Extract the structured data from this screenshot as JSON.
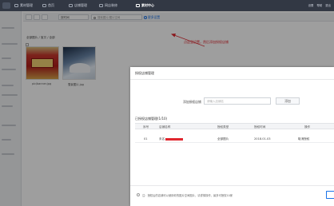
{
  "topbar": {
    "nav": [
      {
        "label": "素材管理",
        "icon": "picture-icon",
        "active": false
      },
      {
        "label": "首页",
        "icon": "home-icon",
        "active": false
      },
      {
        "label": "店铺管理",
        "icon": "shop-icon",
        "active": false
      },
      {
        "label": "网店装修",
        "icon": "decorate-icon",
        "active": false
      },
      {
        "label": "素材中心",
        "icon": "folder-icon",
        "active": true
      }
    ],
    "right_items": [
      "设置",
      "帮助",
      "退出"
    ]
  },
  "toolbar": {
    "sort_select": "按时间",
    "search_placeholder": "搜索图片/图片空间",
    "more_settings": "更多设置"
  },
  "breadcrumb": "全部图片 / 宝贝 / 全部",
  "thumbnails": [
    {
      "caption": "pic/banner.jpg"
    },
    {
      "caption": "雪景图片.jpg"
    }
  ],
  "annotation": "点这里设置，然后添加授权店铺",
  "modal": {
    "title": "授权店铺管理",
    "add_label": "添加授权店铺",
    "add_placeholder": "请输入店铺名",
    "add_button": "添加",
    "list_title": "已授权店铺管理(1/10)",
    "columns": [
      "序号",
      "店铺名称",
      "授权类型",
      "授权时间",
      "操作"
    ],
    "rows": [
      {
        "index": "01",
        "shop": "未名",
        "type": "全部图片",
        "date": "2018.01.03",
        "action": "取消授权"
      }
    ],
    "footer_tip": "注：授权后的店铺可以使用你的图片空间图片，请谨慎操作，最多可授权10家"
  },
  "colors": {
    "accent": "#1a73e8",
    "annotation_red": "#e0262e",
    "topbar_bg": "#323844"
  }
}
